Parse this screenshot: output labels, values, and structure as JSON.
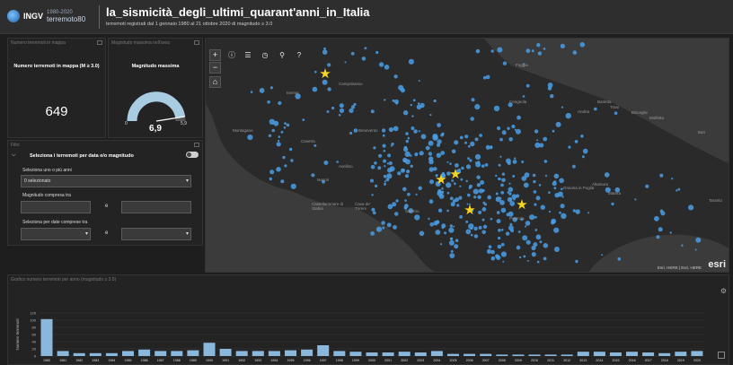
{
  "header": {
    "logo_text": "INGV",
    "logo_sub_top": "1980-2020",
    "logo_sub": "terremoto80",
    "title": "la_sismicità_degli_ultimi_quarant'anni_in_Italia",
    "subtitle": "terremoti registrati dal 1 gennaio 1980 al 21 ottobre 2020 di magnitudo ≥ 3.0"
  },
  "count_panel": {
    "title": "Numero terremoti in mappa",
    "label": "Numero terremoti in mappa (M ≥ 3.0)",
    "value": "649"
  },
  "mag_panel": {
    "title": "Magnitudo massima nell'area",
    "label": "Magnitudo massima",
    "min": "0",
    "max": "5,9",
    "value": "6,9",
    "gauge_fraction": 0.95
  },
  "filter_panel": {
    "title": "Filtri",
    "header": "Seleziona i terremoti per data e/o magnitudo",
    "years_label": "Seleziona uno o più anni",
    "years_value": "0 selezionato",
    "mag_label": "Magnitudo compresa tra",
    "mag_sep": "e",
    "date_label": "Seleziona per date comprese tra",
    "date_sep": "e"
  },
  "map": {
    "tools": [
      "+",
      "−"
    ],
    "home_icon": "home-icon",
    "attribution": "Esri, HERE | Esri, HERE",
    "esri": "esri",
    "places": [
      {
        "name": "Foggia"
      },
      {
        "name": "Campobasso"
      },
      {
        "name": "Isernia"
      },
      {
        "name": "Cerignola"
      },
      {
        "name": "Andria"
      },
      {
        "name": "Barletta"
      },
      {
        "name": "Trani"
      },
      {
        "name": "Bisceglie"
      },
      {
        "name": "Molfetta"
      },
      {
        "name": "Bari"
      },
      {
        "name": "Benevento"
      },
      {
        "name": "Montagano"
      },
      {
        "name": "Caserta"
      },
      {
        "name": "Avellino"
      },
      {
        "name": "Napoli"
      },
      {
        "name": "Castellammare di Stabia"
      },
      {
        "name": "Cava de' Tirreni"
      },
      {
        "name": "Salerno"
      },
      {
        "name": "Potenza"
      },
      {
        "name": "Matera"
      },
      {
        "name": "Altamura"
      },
      {
        "name": "Gravina in Puglia"
      },
      {
        "name": "Taranto"
      }
    ]
  },
  "chart_panel": {
    "title": "Grafico numero terremoti per anno (magnitudo ≥ 3.0)",
    "ylabel": "Numero terremoti"
  },
  "chart_data": {
    "type": "bar",
    "title": "Grafico numero terremoti per anno (magnitudo ≥ 3.0)",
    "ylabel": "Numero terremoti",
    "ylim": [
      0,
      120
    ],
    "yticks": [
      0,
      20,
      40,
      60,
      80,
      100,
      120
    ],
    "categories": [
      "1980",
      "1981",
      "1982",
      "1983",
      "1984",
      "1985",
      "1986",
      "1987",
      "1988",
      "1989",
      "1990",
      "1991",
      "1992",
      "1993",
      "1994",
      "1995",
      "1996",
      "1997",
      "1998",
      "1999",
      "2000",
      "2001",
      "2002",
      "2003",
      "2004",
      "2005",
      "2006",
      "2007",
      "2008",
      "2009",
      "2010",
      "2011",
      "2012",
      "2013",
      "2014",
      "2015",
      "2016",
      "2017",
      "2018",
      "2019",
      "2020"
    ],
    "values": [
      103,
      14,
      8,
      8,
      8,
      14,
      18,
      14,
      14,
      16,
      37,
      20,
      14,
      14,
      14,
      16,
      18,
      30,
      14,
      12,
      10,
      10,
      12,
      10,
      14,
      6,
      6,
      6,
      4,
      4,
      4,
      4,
      4,
      12,
      12,
      10,
      12,
      10,
      8,
      12,
      14
    ],
    "bar_color": "#8ab8dd",
    "grid": true
  },
  "colors": {
    "quake": "#4a9de6",
    "star": "#f6d523"
  }
}
